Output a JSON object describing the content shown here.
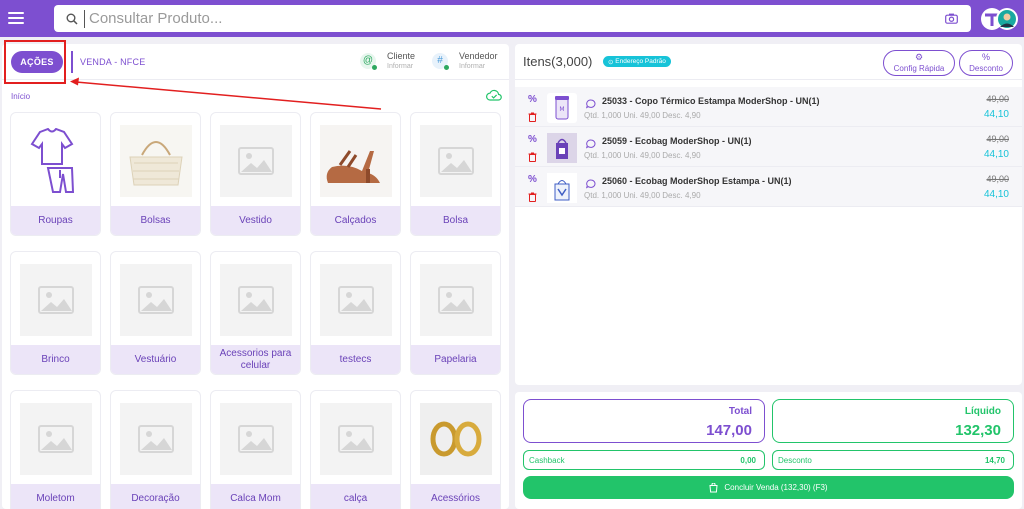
{
  "search": {
    "placeholder": "Consultar Produto..."
  },
  "header": {
    "acoes_label": "AÇÕES",
    "venda_label": "VENDA - NFCE",
    "cliente": {
      "title": "Cliente",
      "sub": "Informar"
    },
    "vendedor": {
      "title": "Vendedor",
      "sub": "Informar"
    }
  },
  "breadcrumb": {
    "inicio": "Início"
  },
  "categories": [
    {
      "label": "Roupas",
      "icon": "clothes-icon"
    },
    {
      "label": "Bolsas",
      "icon": "handbag-photo"
    },
    {
      "label": "Vestido",
      "icon": "image-placeholder-icon"
    },
    {
      "label": "Calçados",
      "icon": "sandal-photo"
    },
    {
      "label": "Bolsa",
      "icon": "image-placeholder-icon"
    },
    {
      "label": "Brinco",
      "icon": "image-placeholder-icon"
    },
    {
      "label": "Vestuário",
      "icon": "image-placeholder-icon"
    },
    {
      "label": "Acessorios para celular",
      "icon": "image-placeholder-icon"
    },
    {
      "label": "testecs",
      "icon": "image-placeholder-icon"
    },
    {
      "label": "Papelaria",
      "icon": "image-placeholder-icon"
    },
    {
      "label": "Moletom",
      "icon": "image-placeholder-icon"
    },
    {
      "label": "Decoração",
      "icon": "image-placeholder-icon"
    },
    {
      "label": "Calca Mom",
      "icon": "image-placeholder-icon"
    },
    {
      "label": "calça",
      "icon": "image-placeholder-icon"
    },
    {
      "label": "Acessórios",
      "icon": "earrings-photo"
    }
  ],
  "items_panel": {
    "title": "Itens(3,000)",
    "address_badge": "Endereço Padrão",
    "config_label": "Config Rápida",
    "desconto_label": "Desconto",
    "items": [
      {
        "title": "25033 - Copo Térmico Estampa ModerShop - UN(1)",
        "meta": "Qtd. 1,000  Uni. 49,00  Desc. 4,90",
        "old_price": "49,00",
        "new_price": "44,10"
      },
      {
        "title": "25059 - Ecobag ModerShop - UN(1)",
        "meta": "Qtd. 1,000  Uni. 49,00  Desc. 4,90",
        "old_price": "49,00",
        "new_price": "44,10"
      },
      {
        "title": "25060 - Ecobag ModerShop Estampa - UN(1)",
        "meta": "Qtd. 1,000  Uni. 49,00  Desc. 4,90",
        "old_price": "49,00",
        "new_price": "44,10"
      }
    ]
  },
  "totals": {
    "total_label": "Total",
    "total_value": "147,00",
    "liquido_label": "Líquido",
    "liquido_value": "132,30",
    "cashback_label": "Cashback",
    "cashback_value": "0,00",
    "desconto_label": "Desconto",
    "desconto_value": "14,70",
    "concluir_label": "Concluir Venda (132,30) (F3)"
  },
  "colors": {
    "brand": "#7d4fd0",
    "success": "#22c46a",
    "accent": "#17c3d8",
    "annotation": "#e21f1f"
  }
}
